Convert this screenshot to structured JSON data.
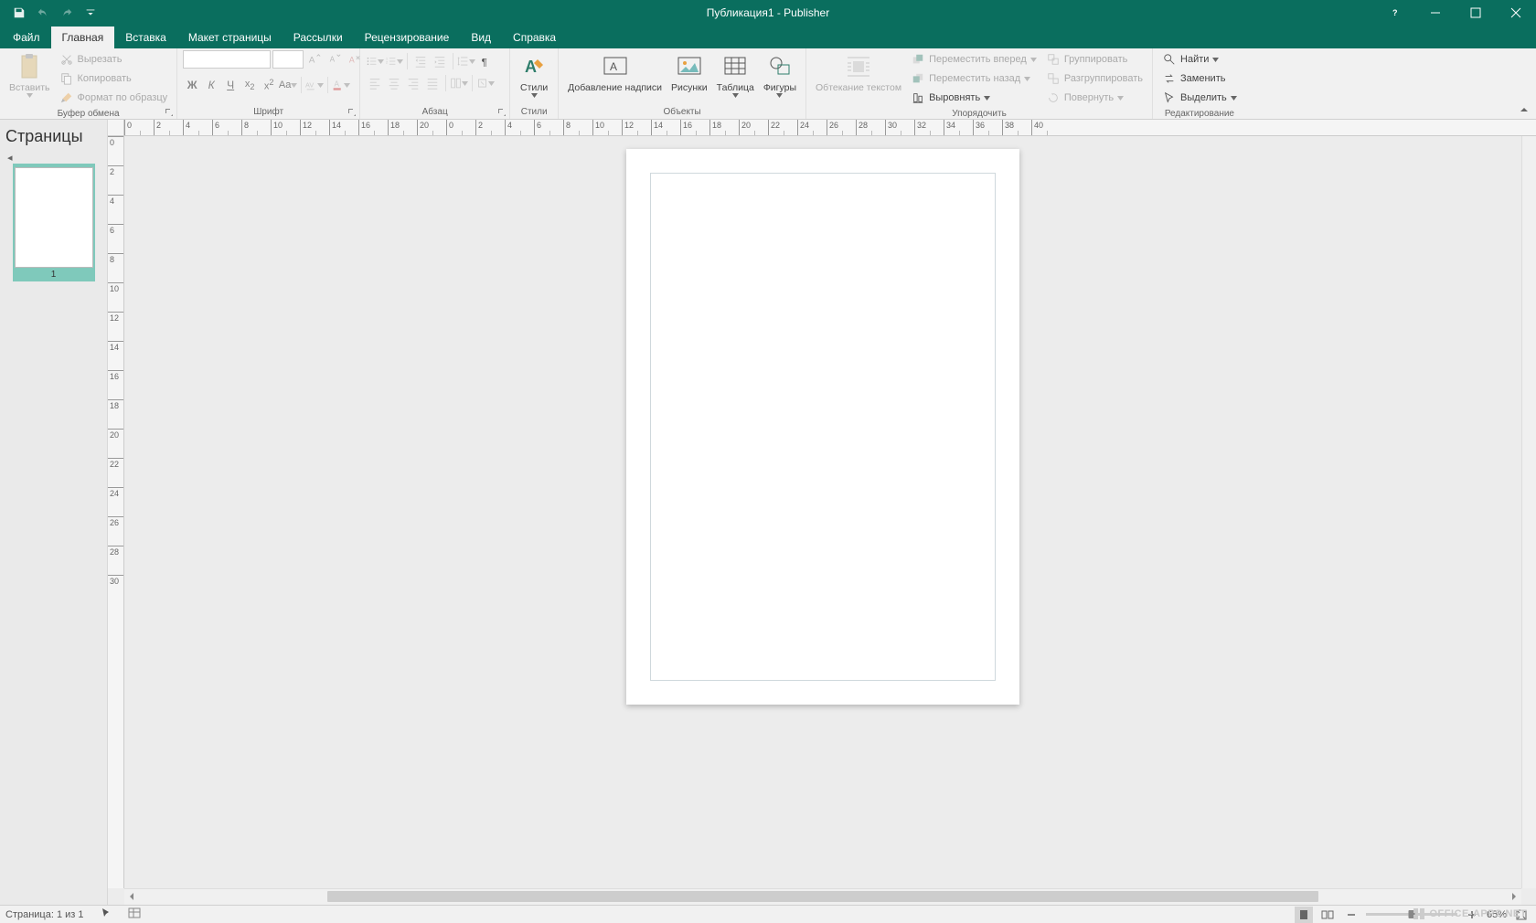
{
  "window": {
    "title": "Публикация1 - Publisher"
  },
  "tabs": {
    "file": "Файл",
    "home": "Главная",
    "insert": "Вставка",
    "pagedesign": "Макет страницы",
    "mailings": "Рассылки",
    "review": "Рецензирование",
    "view": "Вид",
    "help": "Справка"
  },
  "ribbon": {
    "clipboard": {
      "label": "Буфер обмена",
      "paste": "Вставить",
      "cut": "Вырезать",
      "copy": "Копировать",
      "format_painter": "Формат по образцу"
    },
    "font": {
      "label": "Шрифт",
      "bold": "Ж",
      "italic": "К",
      "underline": "Ч",
      "sub": "x₂",
      "sup": "x²",
      "case": "Aa"
    },
    "paragraph": {
      "label": "Абзац"
    },
    "styles": {
      "label": "Стили",
      "btn": "Стили"
    },
    "objects": {
      "label": "Объекты",
      "drawtext": "Добавление надписи",
      "pictures": "Рисунки",
      "table": "Таблица",
      "shapes": "Фигуры"
    },
    "arrange": {
      "label": "Упорядочить",
      "wrap": "Обтекание текстом",
      "forward": "Переместить вперед",
      "backward": "Переместить назад",
      "align": "Выровнять",
      "group": "Группировать",
      "ungroup": "Разгруппировать",
      "rotate": "Повернуть"
    },
    "editing": {
      "label": "Редактирование",
      "find": "Найти",
      "replace": "Заменить",
      "select": "Выделить"
    }
  },
  "pages_panel": {
    "title": "Страницы",
    "page_number": "1"
  },
  "ruler_h": [
    "0",
    "2",
    "4",
    "6",
    "8",
    "10",
    "12",
    "14",
    "16",
    "18",
    "20",
    "0",
    "2",
    "4",
    "6",
    "8",
    "10",
    "12",
    "14",
    "16",
    "18",
    "20",
    "22",
    "24",
    "26",
    "28",
    "30",
    "32",
    "34",
    "36",
    "38",
    "40"
  ],
  "ruler_v": [
    "0",
    "2",
    "4",
    "6",
    "8",
    "10",
    "12",
    "14",
    "16",
    "18",
    "20",
    "22",
    "24",
    "26",
    "28",
    "30"
  ],
  "status": {
    "page": "Страница: 1 из 1",
    "zoom": "65%"
  },
  "watermark": "OFFICE-APPS.NET"
}
